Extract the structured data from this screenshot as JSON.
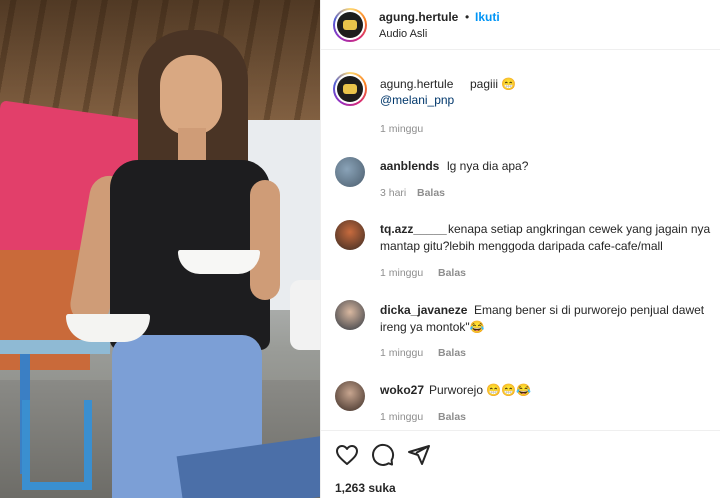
{
  "post": {
    "username": "agung.hertule",
    "separator": "•",
    "follow_label": "Ikuti",
    "audio": "Audio Asli"
  },
  "caption": {
    "username": "agung.hertule",
    "text": "pagiii 😁",
    "mention": "@melani_pnp",
    "time": "1 minggu"
  },
  "comments": [
    {
      "username": "aanblends",
      "text": "lg nya dia apa?",
      "time": "3 hari",
      "reply": "Balas"
    },
    {
      "username": "tq.azz_____",
      "text": "kenapa setiap angkringan cewek yang jagain nya",
      "text2": "mantap gitu?lebih menggoda daripada cafe-cafe/mall",
      "time": "1 minggu",
      "reply": "Balas"
    },
    {
      "username": "dicka_javaneze",
      "text": "Emang bener si di purworejo penjual dawet",
      "text2": "ireng ya montok\"😂",
      "time": "1 minggu",
      "reply": "Balas"
    },
    {
      "username": "woko27",
      "text": "Purworejo 😁😁😂",
      "time": "1 minggu",
      "reply": "Balas"
    }
  ],
  "likes": "1,263 suka",
  "icons": {
    "like": "heart-icon",
    "comment": "comment-icon",
    "share": "share-icon"
  },
  "colors": {
    "accent": "#0095f6",
    "muted": "#8e8e8e"
  }
}
